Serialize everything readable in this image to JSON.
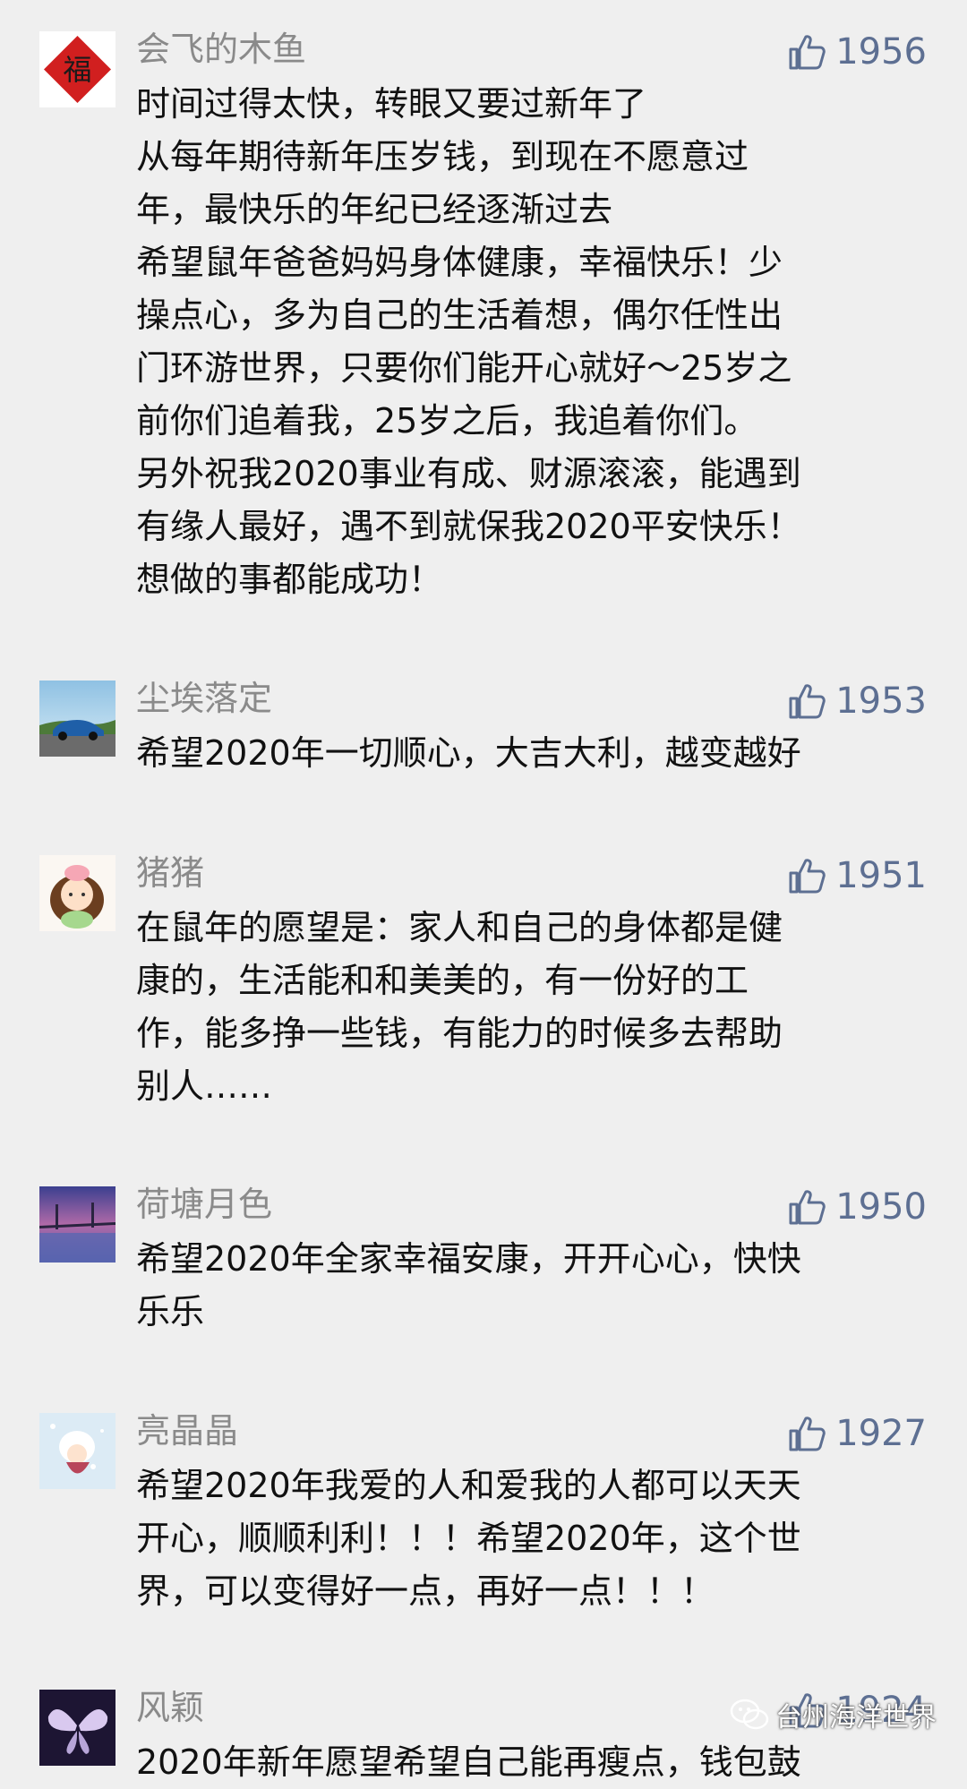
{
  "comments": [
    {
      "nickname": "会飞的木鱼",
      "likes": "1956",
      "lines": [
        "时间过得太快，转眼又要过新年了",
        "从每年期待新年压岁钱，到现在不愿意过",
        "年，最快乐的年纪已经逐渐过去",
        "希望鼠年爸爸妈妈身体健康，幸福快乐！少",
        "操点心，多为自己的生活着想，偶尔任性出",
        "门环游世界，只要你们能开心就好～25岁之",
        "前你们追着我，25岁之后，我追着你们。",
        "另外祝我2020事业有成、财源滚滚，能遇到",
        "有缘人最好，遇不到就保我2020平安快乐！",
        "想做的事都能成功！"
      ],
      "avatar_text": "福"
    },
    {
      "nickname": "尘埃落定",
      "likes": "1953",
      "lines": [
        "希望2020年一切顺心，大吉大利，越变越好"
      ]
    },
    {
      "nickname": "猪猪",
      "likes": "1951",
      "lines": [
        "在鼠年的愿望是：家人和自己的身体都是健",
        "康的，生活能和和美美的，有一份好的工",
        "作，能多挣一些钱，有能力的时候多去帮助",
        "别人……"
      ]
    },
    {
      "nickname": "荷塘月色",
      "likes": "1950",
      "lines": [
        "希望2020年全家幸福安康，开开心心，快快",
        "乐乐"
      ]
    },
    {
      "nickname": "亮晶晶",
      "likes": "1927",
      "lines": [
        "希望2020年我爱的人和爱我的人都可以天天",
        "开心，顺顺利利！！！希望2020年，这个世",
        "界，可以变得好一点，再好一点！！！"
      ]
    },
    {
      "nickname": "风颖",
      "likes": "1924",
      "lines": [
        "2020年新年愿望希望自己能再瘦点，钱包鼓"
      ]
    }
  ],
  "watermark": "台州海洋世界",
  "colors": {
    "background": "#efefef",
    "nickname": "#8a8a8a",
    "like": "#5d6f92",
    "content": "#111111"
  },
  "icons": {
    "like": "thumbs-up-icon",
    "watermark": "wechat-icon"
  }
}
